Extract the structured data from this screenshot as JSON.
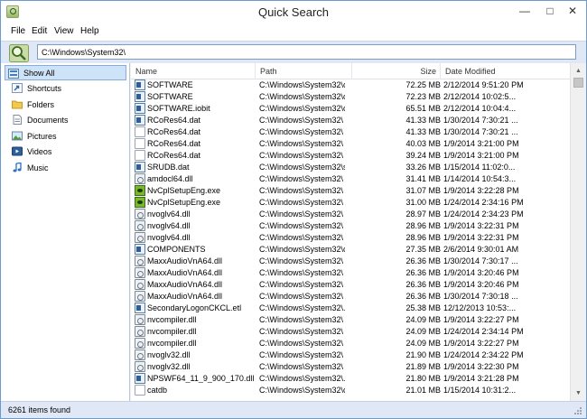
{
  "window": {
    "title": "Quick Search"
  },
  "menu": [
    "File",
    "Edit",
    "View",
    "Help"
  ],
  "path_input": {
    "value": "C:\\Windows\\System32\\"
  },
  "sidebar": {
    "items": [
      {
        "label": "Show All",
        "icon": "show-all-icon",
        "selected": true
      },
      {
        "label": "Shortcuts",
        "icon": "shortcut-icon"
      },
      {
        "label": "Folders",
        "icon": "folder-icon"
      },
      {
        "label": "Documents",
        "icon": "document-icon"
      },
      {
        "label": "Pictures",
        "icon": "picture-icon"
      },
      {
        "label": "Videos",
        "icon": "video-icon"
      },
      {
        "label": "Music",
        "icon": "music-icon"
      }
    ]
  },
  "columns": {
    "name": "Name",
    "path": "Path",
    "size": "Size",
    "date": "Date Modified"
  },
  "rows": [
    {
      "icon": "sys",
      "name": "SOFTWARE",
      "path": "C:\\Windows\\System32\\c...",
      "size": "72.25 MB",
      "date": "2/12/2014 9:51:20 PM"
    },
    {
      "icon": "sys",
      "name": "SOFTWARE",
      "path": "C:\\Windows\\System32\\c...",
      "size": "72.23 MB",
      "date": "2/12/2014 10:02:5..."
    },
    {
      "icon": "sys",
      "name": "SOFTWARE.iobit",
      "path": "C:\\Windows\\System32\\c...",
      "size": "65.51 MB",
      "date": "2/12/2014 10:04:4..."
    },
    {
      "icon": "sys",
      "name": "RCoRes64.dat",
      "path": "C:\\Windows\\System32\\",
      "size": "41.33 MB",
      "date": "1/30/2014 7:30:21 ..."
    },
    {
      "icon": "doc",
      "name": "RCoRes64.dat",
      "path": "C:\\Windows\\System32\\",
      "size": "41.33 MB",
      "date": "1/30/2014 7:30:21 ..."
    },
    {
      "icon": "doc",
      "name": "RCoRes64.dat",
      "path": "C:\\Windows\\System32\\",
      "size": "40.03 MB",
      "date": "1/9/2014 3:21:00 PM"
    },
    {
      "icon": "doc",
      "name": "RCoRes64.dat",
      "path": "C:\\Windows\\System32\\",
      "size": "39.24 MB",
      "date": "1/9/2014 3:21:00 PM"
    },
    {
      "icon": "sys",
      "name": "SRUDB.dat",
      "path": "C:\\Windows\\System32\\s...",
      "size": "33.26 MB",
      "date": "1/15/2014 11:02:0..."
    },
    {
      "icon": "gear",
      "name": "amdocl64.dll",
      "path": "C:\\Windows\\System32\\",
      "size": "31.41 MB",
      "date": "1/14/2014 10:54:3..."
    },
    {
      "icon": "nv",
      "name": "NvCplSetupEng.exe",
      "path": "C:\\Windows\\System32\\",
      "size": "31.07 MB",
      "date": "1/9/2014 3:22:28 PM"
    },
    {
      "icon": "nv",
      "name": "NvCplSetupEng.exe",
      "path": "C:\\Windows\\System32\\",
      "size": "31.00 MB",
      "date": "1/24/2014 2:34:16 PM"
    },
    {
      "icon": "gear",
      "name": "nvoglv64.dll",
      "path": "C:\\Windows\\System32\\",
      "size": "28.97 MB",
      "date": "1/24/2014 2:34:23 PM"
    },
    {
      "icon": "gear",
      "name": "nvoglv64.dll",
      "path": "C:\\Windows\\System32\\",
      "size": "28.96 MB",
      "date": "1/9/2014 3:22:31 PM"
    },
    {
      "icon": "gear",
      "name": "nvoglv64.dll",
      "path": "C:\\Windows\\System32\\",
      "size": "28.96 MB",
      "date": "1/9/2014 3:22:31 PM"
    },
    {
      "icon": "sys",
      "name": "COMPONENTS",
      "path": "C:\\Windows\\System32\\c...",
      "size": "27.35 MB",
      "date": "2/6/2014 9:30:01 AM"
    },
    {
      "icon": "gear",
      "name": "MaxxAudioVnA64.dll",
      "path": "C:\\Windows\\System32\\",
      "size": "26.36 MB",
      "date": "1/30/2014 7:30:17 ..."
    },
    {
      "icon": "gear",
      "name": "MaxxAudioVnA64.dll",
      "path": "C:\\Windows\\System32\\",
      "size": "26.36 MB",
      "date": "1/9/2014 3:20:46 PM"
    },
    {
      "icon": "gear",
      "name": "MaxxAudioVnA64.dll",
      "path": "C:\\Windows\\System32\\",
      "size": "26.36 MB",
      "date": "1/9/2014 3:20:46 PM"
    },
    {
      "icon": "gear",
      "name": "MaxxAudioVnA64.dll",
      "path": "C:\\Windows\\System32\\",
      "size": "26.36 MB",
      "date": "1/30/2014 7:30:18 ..."
    },
    {
      "icon": "sys",
      "name": "SecondaryLogonCKCL.etl",
      "path": "C:\\Windows\\System32\\...",
      "size": "25.38 MB",
      "date": "12/12/2013 10:53:..."
    },
    {
      "icon": "gear",
      "name": "nvcompiler.dll",
      "path": "C:\\Windows\\System32\\",
      "size": "24.09 MB",
      "date": "1/9/2014 3:22:27 PM"
    },
    {
      "icon": "gear",
      "name": "nvcompiler.dll",
      "path": "C:\\Windows\\System32\\",
      "size": "24.09 MB",
      "date": "1/24/2014 2:34:14 PM"
    },
    {
      "icon": "gear",
      "name": "nvcompiler.dll",
      "path": "C:\\Windows\\System32\\",
      "size": "24.09 MB",
      "date": "1/9/2014 3:22:27 PM"
    },
    {
      "icon": "gear",
      "name": "nvoglv32.dll",
      "path": "C:\\Windows\\System32\\",
      "size": "21.90 MB",
      "date": "1/24/2014 2:34:22 PM"
    },
    {
      "icon": "gear",
      "name": "nvoglv32.dll",
      "path": "C:\\Windows\\System32\\",
      "size": "21.89 MB",
      "date": "1/9/2014 3:22:30 PM"
    },
    {
      "icon": "sys",
      "name": "NPSWF64_11_9_900_170.dll",
      "path": "C:\\Windows\\System32\\...",
      "size": "21.80 MB",
      "date": "1/9/2014 3:21:28 PM"
    },
    {
      "icon": "doc",
      "name": "catdb",
      "path": "C:\\Windows\\System32\\c...",
      "size": "21.01 MB",
      "date": "1/15/2014 10:31:2..."
    }
  ],
  "status": {
    "text": "6261 items found"
  },
  "colors": {
    "accent": "#3c7fc8",
    "selection": "#cfe3f8",
    "bar": "#dfe8f4"
  }
}
